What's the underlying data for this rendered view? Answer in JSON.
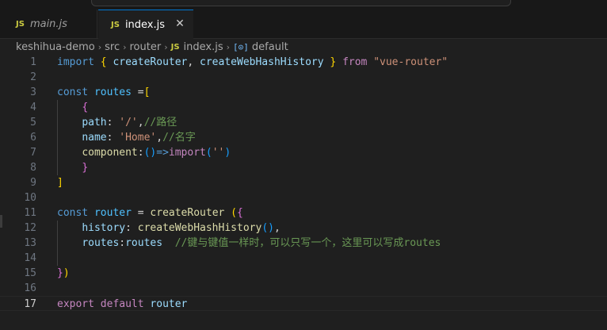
{
  "tabs": [
    {
      "icon": "JS",
      "label": "main.js",
      "active": false
    },
    {
      "icon": "JS",
      "label": "index.js",
      "active": true,
      "close": "✕"
    }
  ],
  "breadcrumb": {
    "parts": [
      "keshihua-demo",
      "src",
      "router"
    ],
    "file_icon": "JS",
    "file": "index.js",
    "symbol_icon": "[⊙]",
    "symbol": "default",
    "sep": "›"
  },
  "current_line": 17,
  "lines": [
    {
      "n": 1,
      "tokens": [
        [
          "kw",
          "import"
        ],
        [
          "p",
          " "
        ],
        [
          "b1",
          "{"
        ],
        [
          "p",
          " "
        ],
        [
          "var",
          "createRouter"
        ],
        [
          "p",
          ", "
        ],
        [
          "var",
          "createWebHashHistory"
        ],
        [
          "p",
          " "
        ],
        [
          "b1",
          "}"
        ],
        [
          "p",
          " "
        ],
        [
          "ctrl",
          "from"
        ],
        [
          "p",
          " "
        ],
        [
          "str",
          "\"vue-router\""
        ]
      ]
    },
    {
      "n": 2,
      "tokens": []
    },
    {
      "n": 3,
      "tokens": [
        [
          "kw",
          "const"
        ],
        [
          "p",
          " "
        ],
        [
          "const",
          "routes"
        ],
        [
          "p",
          " ="
        ],
        [
          "b1",
          "["
        ]
      ]
    },
    {
      "n": 4,
      "tokens": [
        [
          "p",
          "    "
        ],
        [
          "b2",
          "{"
        ]
      ]
    },
    {
      "n": 5,
      "tokens": [
        [
          "p",
          "    "
        ],
        [
          "var",
          "path"
        ],
        [
          "p",
          ": "
        ],
        [
          "str",
          "'/'"
        ],
        [
          "p",
          ","
        ],
        [
          "cmt",
          "//路径"
        ]
      ]
    },
    {
      "n": 6,
      "tokens": [
        [
          "p",
          "    "
        ],
        [
          "var",
          "name"
        ],
        [
          "p",
          ": "
        ],
        [
          "str",
          "'Home'"
        ],
        [
          "p",
          ","
        ],
        [
          "cmt",
          "//名字"
        ]
      ]
    },
    {
      "n": 7,
      "tokens": [
        [
          "p",
          "    "
        ],
        [
          "fn",
          "component"
        ],
        [
          "p",
          ":"
        ],
        [
          "b3",
          "()"
        ],
        [
          "kw",
          "=>"
        ],
        [
          "ctrl",
          "import"
        ],
        [
          "b3",
          "("
        ],
        [
          "str",
          "''"
        ],
        [
          "b3",
          ")"
        ]
      ]
    },
    {
      "n": 8,
      "tokens": [
        [
          "p",
          "    "
        ],
        [
          "b2",
          "}"
        ]
      ]
    },
    {
      "n": 9,
      "tokens": [
        [
          "b1",
          "]"
        ]
      ]
    },
    {
      "n": 10,
      "tokens": []
    },
    {
      "n": 11,
      "tokens": [
        [
          "kw",
          "const"
        ],
        [
          "p",
          " "
        ],
        [
          "const",
          "router"
        ],
        [
          "p",
          " = "
        ],
        [
          "fn",
          "createRouter"
        ],
        [
          "p",
          " "
        ],
        [
          "b1",
          "("
        ],
        [
          "b2",
          "{"
        ]
      ]
    },
    {
      "n": 12,
      "tokens": [
        [
          "p",
          "    "
        ],
        [
          "var",
          "history"
        ],
        [
          "p",
          ": "
        ],
        [
          "fn",
          "createWebHashHistory"
        ],
        [
          "b3",
          "()"
        ],
        [
          "p",
          ","
        ]
      ]
    },
    {
      "n": 13,
      "tokens": [
        [
          "p",
          "    "
        ],
        [
          "var",
          "routes"
        ],
        [
          "p",
          ":"
        ],
        [
          "var",
          "routes"
        ],
        [
          "p",
          "  "
        ],
        [
          "cmt",
          "//键与键值一样时，可以只写一个，这里可以写成routes"
        ]
      ]
    },
    {
      "n": 14,
      "tokens": []
    },
    {
      "n": 15,
      "tokens": [
        [
          "b2",
          "}"
        ],
        [
          "b1",
          ")"
        ]
      ]
    },
    {
      "n": 16,
      "tokens": []
    },
    {
      "n": 17,
      "tokens": [
        [
          "ctrl",
          "export"
        ],
        [
          "p",
          " "
        ],
        [
          "ctrl",
          "default"
        ],
        [
          "p",
          " "
        ],
        [
          "var",
          "router"
        ]
      ]
    }
  ]
}
